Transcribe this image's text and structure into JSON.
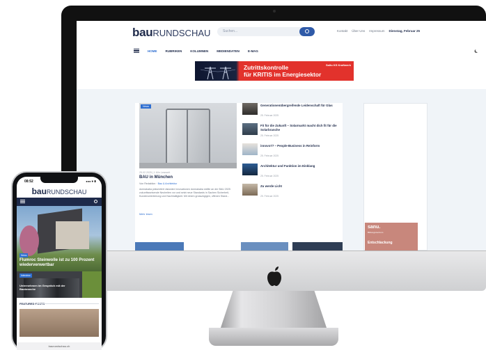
{
  "desktop": {
    "logo": {
      "bold": "bau",
      "thin": "RUNDSCHAU"
    },
    "search_placeholder": "Suchen...",
    "top_links": [
      "Kontakt",
      "Über Uns",
      "Impressum"
    ],
    "date": "Dienstag, Februar 25",
    "nav": [
      "HOME",
      "RUBRIKEN",
      "KOLUMNEN",
      "MEDIENDATEN",
      "E-MAG"
    ],
    "banner": {
      "line1": "Zutrittskontrolle",
      "line2": "für KRITIS im Energiesektor",
      "brand": "Salto KS Kraftwerk"
    },
    "featured": {
      "tag": "News",
      "meta": "25.02.2025 | 1 Min Lesezeit",
      "title": "BAU in München",
      "author": "Von Redaktion",
      "category": "Bau & Architektur",
      "excerpt": "dormakaba präsentiert visionäre Innovationen dormakaba stellte an der BAU 2025 zukunftsweisende Neuheiten vor und setzt neue Standards in Sachen Sicherheit, Kundenorientierung und Nachhaltigkeit. Mit einem grosszügigen, offenen Stand...",
      "more": "Mehr lesen"
    },
    "side_items": [
      {
        "title": "Generationenübergreifende Leidenschaft für Glas",
        "date": "25. Februar 2025"
      },
      {
        "title": "Fit für die Zukunft – Solarmarkt macht dich fit für die Solarbranche",
        "date": "25. Februar 2025"
      },
      {
        "title": "innovo77 – People-Business in Reinform",
        "date": "25. Februar 2025"
      },
      {
        "title": "Architektur und Funktion im Einklang",
        "date": "25. Februar 2025"
      },
      {
        "title": "Zu werde Licht",
        "date": "25. Februar 2025"
      }
    ],
    "ad": {
      "brand": "sanu.",
      "tagline": "Bildungszentrum",
      "text": "Entschlackung"
    }
  },
  "phone": {
    "time": "08:52",
    "signal": "●●● ⌖ ▮",
    "logo": {
      "bold": "bau",
      "thin": "RUNDSCHAU"
    },
    "hero_tag": "News",
    "hero_title": "Flumroc Steinwolle ist zu 100 Prozent wiederverwertbar",
    "row_tag": "Interview",
    "row_title": "Unternehmen im Gespräch mit der Baubranche",
    "featured_label": "FEATURED POSTS",
    "url": "baurundschau.ch"
  }
}
